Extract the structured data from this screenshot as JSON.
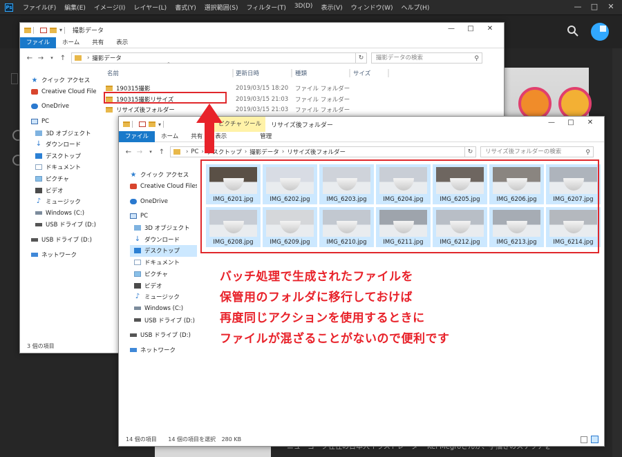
{
  "photoshop": {
    "menu": [
      "ファイル(F)",
      "編集(E)",
      "イメージ(I)",
      "レイヤー(L)",
      "書式(Y)",
      "選択範囲(S)",
      "フィルター(T)",
      "3D(D)",
      "表示(V)",
      "ウィンドウ(W)",
      "ヘルプ(H)"
    ],
    "logo": "Ps",
    "caption": "ニューヨーク在住の日本人イラストレーター Kei Megroさんが、手描きのスケッチを"
  },
  "window1": {
    "title": "撮影データ",
    "ribbon": [
      "ファイル",
      "ホーム",
      "共有",
      "表示"
    ],
    "address": [
      "撮影データ"
    ],
    "search_placeholder": "撮影データの検索",
    "columns": {
      "name": "名前",
      "date": "更新日時",
      "type": "種類",
      "size": "サイズ"
    },
    "files": [
      {
        "name": "190315撮影",
        "date": "2019/03/15 18:20",
        "type": "ファイル フォルダー"
      },
      {
        "name": "190315撮影リサイズ",
        "date": "2019/03/15 21:03",
        "type": "ファイル フォルダー"
      },
      {
        "name": "リサイズ後フォルダー",
        "date": "2019/03/15 21:03",
        "type": "ファイル フォルダー"
      }
    ],
    "nav": [
      {
        "label": "クイック アクセス",
        "icon": "star-icon"
      },
      {
        "label": "Creative Cloud Files",
        "icon": "creative-cloud-icon"
      },
      {
        "label": "OneDrive",
        "icon": "onedrive-icon"
      },
      {
        "label": "PC",
        "icon": "pc-icon"
      },
      {
        "label": "3D オブジェクト",
        "icon": "3d-objects-icon"
      },
      {
        "label": "ダウンロード",
        "icon": "download-icon"
      },
      {
        "label": "デスクトップ",
        "icon": "desktop-icon"
      },
      {
        "label": "ドキュメント",
        "icon": "documents-icon"
      },
      {
        "label": "ピクチャ",
        "icon": "pictures-icon"
      },
      {
        "label": "ビデオ",
        "icon": "video-icon"
      },
      {
        "label": "ミュージック",
        "icon": "music-icon"
      },
      {
        "label": "Windows (C:)",
        "icon": "drive-icon"
      },
      {
        "label": "USB ドライブ (D:)",
        "icon": "usb-drive-icon"
      },
      {
        "label": "USB ドライブ (D:)",
        "icon": "usb-drive-icon"
      },
      {
        "label": "ネットワーク",
        "icon": "network-icon"
      }
    ],
    "status": "3 個の項目"
  },
  "window2": {
    "title": "リサイズ後フォルダー",
    "context_tab": "ピクチャ ツール",
    "context_sub": "管理",
    "ribbon": [
      "ファイル",
      "ホーム",
      "共有",
      "表示"
    ],
    "address": [
      "PC",
      "デスクトップ",
      "撮影データ",
      "リサイズ後フォルダー"
    ],
    "search_placeholder": "リサイズ後フォルダーの検索",
    "nav": [
      {
        "label": "クイック アクセス",
        "icon": "star-icon"
      },
      {
        "label": "Creative Cloud Files",
        "icon": "creative-cloud-icon"
      },
      {
        "label": "OneDrive",
        "icon": "onedrive-icon"
      },
      {
        "label": "PC",
        "icon": "pc-icon"
      },
      {
        "label": "3D オブジェクト",
        "icon": "3d-objects-icon"
      },
      {
        "label": "ダウンロード",
        "icon": "download-icon"
      },
      {
        "label": "デスクトップ",
        "icon": "desktop-icon",
        "selected": true
      },
      {
        "label": "ドキュメント",
        "icon": "documents-icon"
      },
      {
        "label": "ピクチャ",
        "icon": "pictures-icon"
      },
      {
        "label": "ビデオ",
        "icon": "video-icon"
      },
      {
        "label": "ミュージック",
        "icon": "music-icon"
      },
      {
        "label": "Windows (C:)",
        "icon": "drive-icon"
      },
      {
        "label": "USB ドライブ (D:)",
        "icon": "usb-drive-icon"
      },
      {
        "label": "USB ドライブ (D:)",
        "icon": "usb-drive-icon"
      },
      {
        "label": "ネットワーク",
        "icon": "network-icon"
      }
    ],
    "thumbnails": [
      "IMG_6201.jpg",
      "IMG_6202.jpg",
      "IMG_6203.jpg",
      "IMG_6204.jpg",
      "IMG_6205.jpg",
      "IMG_6206.jpg",
      "IMG_6207.jpg",
      "IMG_6208.jpg",
      "IMG_6209.jpg",
      "IMG_6210.jpg",
      "IMG_6211.jpg",
      "IMG_6212.jpg",
      "IMG_6213.jpg",
      "IMG_6214.jpg"
    ],
    "status_count": "14 個の項目",
    "status_selected": "14 個の項目を選択",
    "status_size": "280 KB"
  },
  "annotation": [
    "バッチ処理で生成されたファイルを",
    "保管用のフォルダに移行しておけば",
    "再度同じアクションを使用するときに",
    "ファイルが混ざることがないので便利です"
  ],
  "colors": {
    "annotation_red": "#e8222a",
    "selection_blue": "#cce8ff",
    "file_tab_blue": "#1979ca",
    "ps_accent": "#31a8ff"
  }
}
